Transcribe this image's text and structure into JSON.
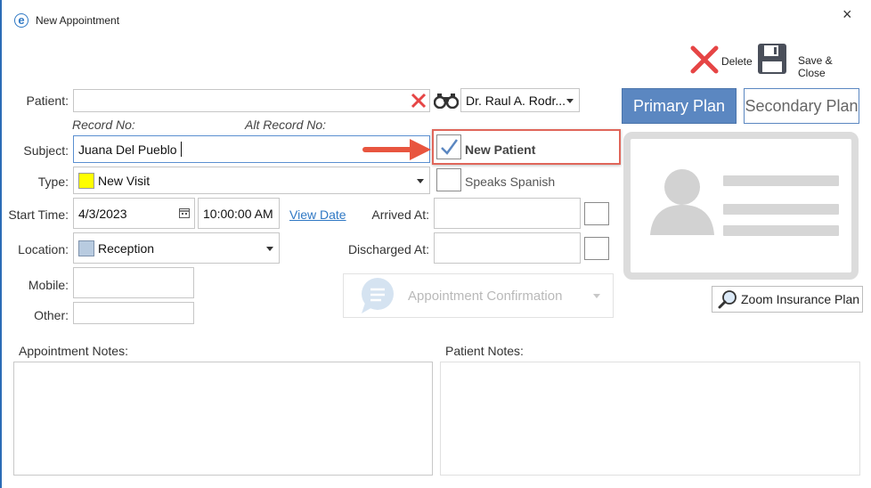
{
  "window": {
    "title": "New Appointment",
    "app_icon_glyph": "e",
    "close_glyph": "×"
  },
  "toolbar": {
    "delete_label": "Delete",
    "save_close_label": "Save & Close"
  },
  "form": {
    "patient": {
      "label": "Patient:",
      "value": ""
    },
    "record_no_label": "Record No:",
    "alt_record_no_label": "Alt Record No:",
    "provider": {
      "value": "Dr. Raul A. Rodr..."
    },
    "subject": {
      "label": "Subject:",
      "value": "Juana Del Pueblo"
    },
    "new_patient": {
      "label": "New Patient",
      "checked": true
    },
    "type": {
      "label": "Type:",
      "value": "New Visit",
      "color": "#ffff00"
    },
    "speaks_spanish": {
      "label": "Speaks Spanish",
      "checked": false
    },
    "start_time": {
      "label": "Start Time:",
      "date": "4/3/2023",
      "time": "10:00:00 AM"
    },
    "view_date_link": "View Date",
    "arrived_at": {
      "label": "Arrived At:",
      "value": ""
    },
    "location": {
      "label": "Location:",
      "value": "Reception",
      "color": "#b8cbe0"
    },
    "discharged_at": {
      "label": "Discharged At:",
      "value": ""
    },
    "mobile": {
      "label": "Mobile:",
      "value": ""
    },
    "other": {
      "label": "Other:",
      "value": ""
    },
    "appointment_confirmation": {
      "label": "Appointment Confirmation"
    }
  },
  "insurance": {
    "primary_plan_label": "Primary Plan",
    "secondary_plan_label": "Secondary Plan",
    "zoom_label": "Zoom Insurance Plan"
  },
  "notes": {
    "appointment_notes_label": "Appointment Notes:",
    "patient_notes_label": "Patient Notes:"
  },
  "colors": {
    "accent": "#5b87c1",
    "highlight_box": "#e0665a",
    "arrow": "#e8553f",
    "delete_red": "#e64545"
  }
}
